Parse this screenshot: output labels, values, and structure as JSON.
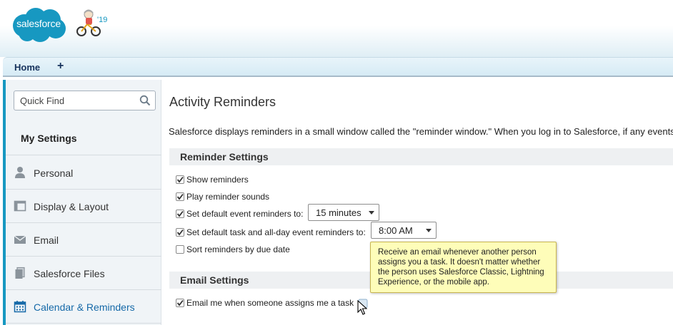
{
  "header": {
    "logo_text": "salesforce",
    "release_badge": "'19",
    "colors": {
      "brand": "#1798c1"
    }
  },
  "tabs": {
    "home_label": "Home",
    "add_label": "+"
  },
  "sidebar": {
    "search_placeholder": "Quick Find",
    "section_title": "My Settings",
    "items": [
      {
        "label": "Personal",
        "icon": "person-icon"
      },
      {
        "label": "Display & Layout",
        "icon": "layout-icon"
      },
      {
        "label": "Email",
        "icon": "envelope-icon"
      },
      {
        "label": "Salesforce Files",
        "icon": "files-icon"
      },
      {
        "label": "Calendar & Reminders",
        "icon": "calendar-icon",
        "active": true
      }
    ]
  },
  "main": {
    "title": "Activity Reminders",
    "intro": "Salesforce displays reminders in a small window called the \"reminder window.\" When you log in to Salesforce, if any events",
    "reminder_settings": {
      "heading": "Reminder Settings",
      "show_reminders": "Show reminders",
      "play_sounds": "Play reminder sounds",
      "event_default_label": "Set default event reminders to:",
      "event_default_value": "15 minutes",
      "task_default_label": "Set default task and all-day event reminders to:",
      "task_default_value": "8:00 AM",
      "sort_label": "Sort reminders by due date"
    },
    "email_settings": {
      "heading": "Email Settings",
      "assign_label": "Email me when someone assigns me a task"
    },
    "tooltip": "Receive an email whenever another person assigns you a task. It doesn't matter whether the person uses Salesforce Classic, Lightning Experience, or the mobile app."
  }
}
